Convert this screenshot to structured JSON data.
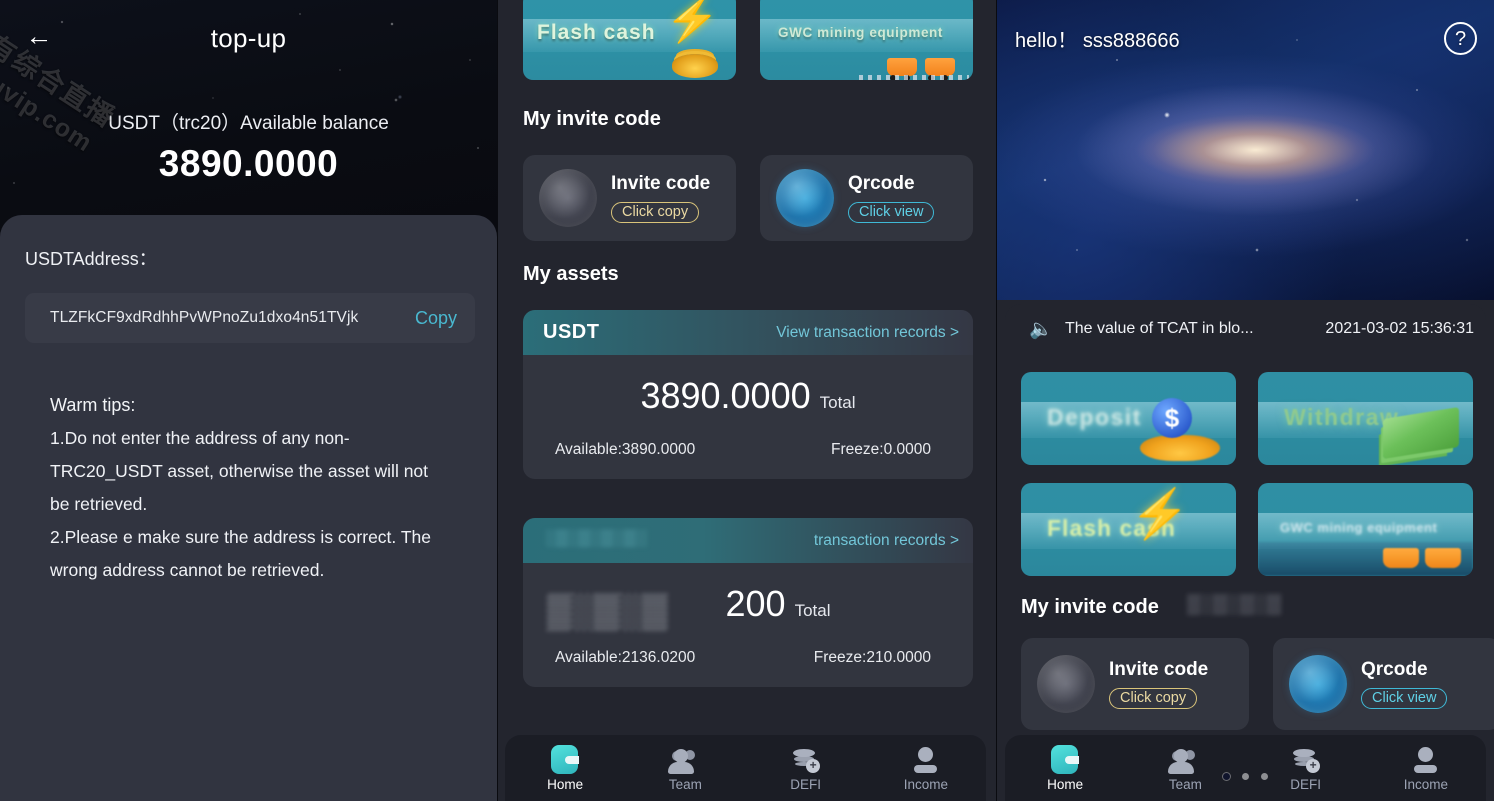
{
  "topup": {
    "watermark_line1": "免都有综合直播",
    "watermark_line2": "douyouvip.com",
    "back_icon": "back-arrow-icon",
    "title": "top-up",
    "balance_label": "USDT（trc20）Available balance",
    "balance_value": "3890.0000",
    "address_label": "USDTAddress：",
    "address_value": "TLZFkCF9xdRdhhPvWPnoZu1dxo4n51TVjk",
    "copy_label": "Copy",
    "tips_title": "Warm tips:",
    "tips_body": "1.Do not enter the address of any non-TRC20_USDT asset, otherwise the asset will not be retrieved.\n2.Please e make sure the address is correct. The wrong address cannot be retrieved."
  },
  "middle": {
    "banners": [
      {
        "label": "Flash cash",
        "icon": "lightning-bolt-icon"
      },
      {
        "label": "GWC mining equipment",
        "icon": "mining-cart-icon"
      }
    ],
    "invite_title": "My invite code",
    "invite_cards": [
      {
        "title": "Invite code",
        "action": "Click copy",
        "icon": "globe-grey-icon"
      },
      {
        "title": "Qrcode",
        "action": "Click view",
        "icon": "globe-blue-icon"
      }
    ],
    "assets_title": "My assets",
    "assets": [
      {
        "symbol": "USDT",
        "records_link": "View transaction records >",
        "total": "3890.0000",
        "total_label": "Total",
        "available": "Available:3890.0000",
        "freeze": "Freeze:0.0000"
      },
      {
        "symbol": "",
        "records_link": "transaction records >",
        "total": "200",
        "total_label": "Total",
        "available": "Available:2136.0200",
        "freeze": "Freeze:210.0000"
      }
    ],
    "nav": [
      {
        "label": "Home",
        "icon": "wallet-icon",
        "active": true
      },
      {
        "label": "Team",
        "icon": "people-icon",
        "active": false
      },
      {
        "label": "DEFI",
        "icon": "coins-plus-icon",
        "active": false
      },
      {
        "label": "Income",
        "icon": "person-icon",
        "active": false
      }
    ]
  },
  "right": {
    "greeting": "hello！",
    "username": "sss888666",
    "help_icon": "question-mark-icon",
    "hero_image": "galaxy-banner",
    "carousel_dots": 3,
    "carousel_active": 0,
    "notice_icon": "speaker-icon",
    "notice_text": "The value of TCAT in blo...",
    "notice_time": "2021-03-02 15:36:31",
    "action_banners": [
      {
        "label": "Deposit",
        "icon": "dollar-coin-icon"
      },
      {
        "label": "Withdraw",
        "icon": "cash-stack-icon"
      },
      {
        "label": "Flash cash",
        "icon": "lightning-bolt-icon"
      },
      {
        "label": "GWC mining equipment",
        "icon": "mining-cart-icon"
      }
    ],
    "invite_title": "My invite code",
    "invite_cards": [
      {
        "title": "Invite code",
        "action": "Click copy",
        "icon": "globe-grey-icon"
      },
      {
        "title": "Qrcode",
        "action": "Click view",
        "icon": "globe-blue-icon"
      }
    ],
    "nav": [
      {
        "label": "Home",
        "icon": "wallet-icon",
        "active": true
      },
      {
        "label": "Team",
        "icon": "people-icon",
        "active": false
      },
      {
        "label": "DEFI",
        "icon": "coins-plus-icon",
        "active": false
      },
      {
        "label": "Income",
        "icon": "person-icon",
        "active": false
      }
    ]
  },
  "colors": {
    "accent_teal": "#2f93a8",
    "link_cyan": "#72c6d8",
    "panel_bg": "#23252e",
    "card_bg": "#32353f",
    "sheet_bg": "#313440",
    "nav_bg": "#1b1d25",
    "active_nav": "#53e2dd"
  }
}
